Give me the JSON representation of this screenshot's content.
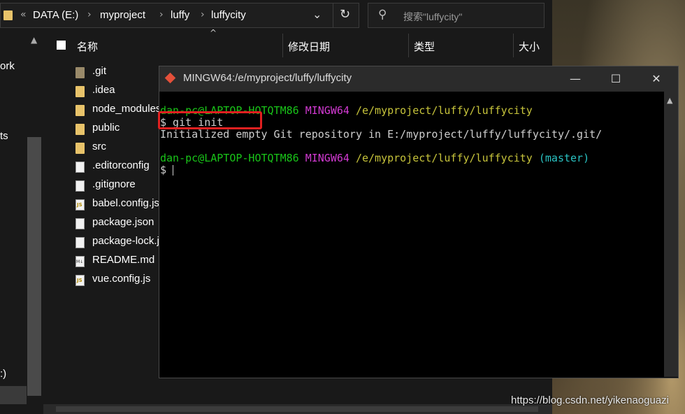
{
  "address_bar": {
    "overflow": "«",
    "crumbs": [
      "DATA (E:)",
      "myproject",
      "luffy",
      "luffycity"
    ]
  },
  "search": {
    "placeholder": "搜索\"luffycity\""
  },
  "nav_pane": {
    "items": [
      "ork",
      "ts",
      ":)"
    ]
  },
  "columns": {
    "name": "名称",
    "date": "修改日期",
    "type": "类型",
    "size": "大小"
  },
  "files": [
    {
      "name": ".git",
      "icon": "folder-icon"
    },
    {
      "name": ".idea",
      "icon": "folder-icon"
    },
    {
      "name": "node_modules",
      "icon": "folder-icon"
    },
    {
      "name": "public",
      "icon": "folder-icon"
    },
    {
      "name": "src",
      "icon": "folder-icon"
    },
    {
      "name": ".editorconfig",
      "icon": "file-icon"
    },
    {
      "name": ".gitignore",
      "icon": "file-icon"
    },
    {
      "name": "babel.config.js",
      "icon": "js-file-icon"
    },
    {
      "name": "package.json",
      "icon": "file-icon"
    },
    {
      "name": "package-lock.json",
      "icon": "file-icon"
    },
    {
      "name": "README.md",
      "icon": "markdown-file-icon"
    },
    {
      "name": "vue.config.js",
      "icon": "js-file-icon"
    }
  ],
  "terminal": {
    "title": "MINGW64:/e/myproject/luffy/luffycity",
    "user_host": "dan-pc@LAPTOP-HOTQTM86",
    "shell": "MINGW64",
    "path": "/e/myproject/luffy/luffycity",
    "command": "$ git init",
    "output": "Initialized empty Git repository in E:/myproject/luffy/luffycity/.git/",
    "branch": "(master)",
    "prompt": "$"
  },
  "watermark": "https://blog.csdn.net/yikenaoguazi",
  "colors": {
    "prompt_user": "#19c519",
    "prompt_shell": "#d33ad3",
    "prompt_path": "#c7c43b",
    "branch": "#2ac3c3",
    "highlight": "#e02020"
  }
}
